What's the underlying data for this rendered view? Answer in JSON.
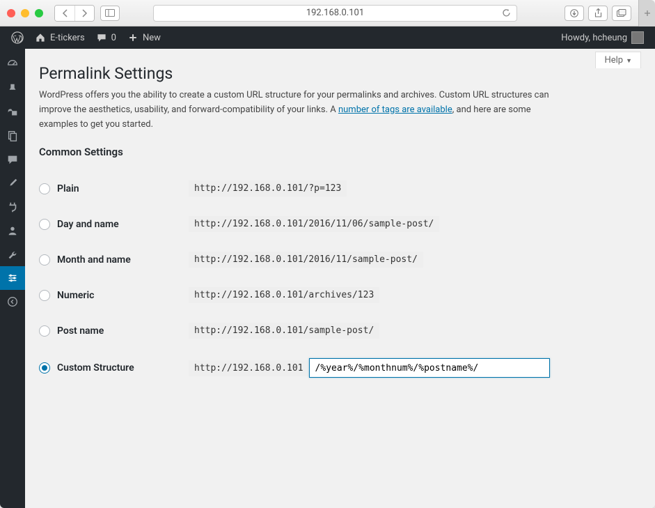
{
  "browser": {
    "address": "192.168.0.101"
  },
  "adminbar": {
    "site_name": "E-tickers",
    "comments_count": "0",
    "new_label": "New",
    "greeting": "Howdy, hcheung"
  },
  "help": {
    "label": "Help"
  },
  "page": {
    "title": "Permalink Settings",
    "intro_before_link": "WordPress offers you the ability to create a custom URL structure for your permalinks and archives. Custom URL structures can improve the aesthetics, usability, and forward-compatibility of your links. A ",
    "intro_link": "number of tags are available",
    "intro_after_link": ", and here are some examples to get you started.",
    "section_common": "Common Settings"
  },
  "options": {
    "plain": {
      "label": "Plain",
      "example": "http://192.168.0.101/?p=123"
    },
    "day_name": {
      "label": "Day and name",
      "example": "http://192.168.0.101/2016/11/06/sample-post/"
    },
    "month_name": {
      "label": "Month and name",
      "example": "http://192.168.0.101/2016/11/sample-post/"
    },
    "numeric": {
      "label": "Numeric",
      "example": "http://192.168.0.101/archives/123"
    },
    "post_name": {
      "label": "Post name",
      "example": "http://192.168.0.101/sample-post/"
    },
    "custom": {
      "label": "Custom Structure",
      "prefix": "http://192.168.0.101",
      "value": "/%year%/%monthnum%/%postname%/"
    }
  }
}
